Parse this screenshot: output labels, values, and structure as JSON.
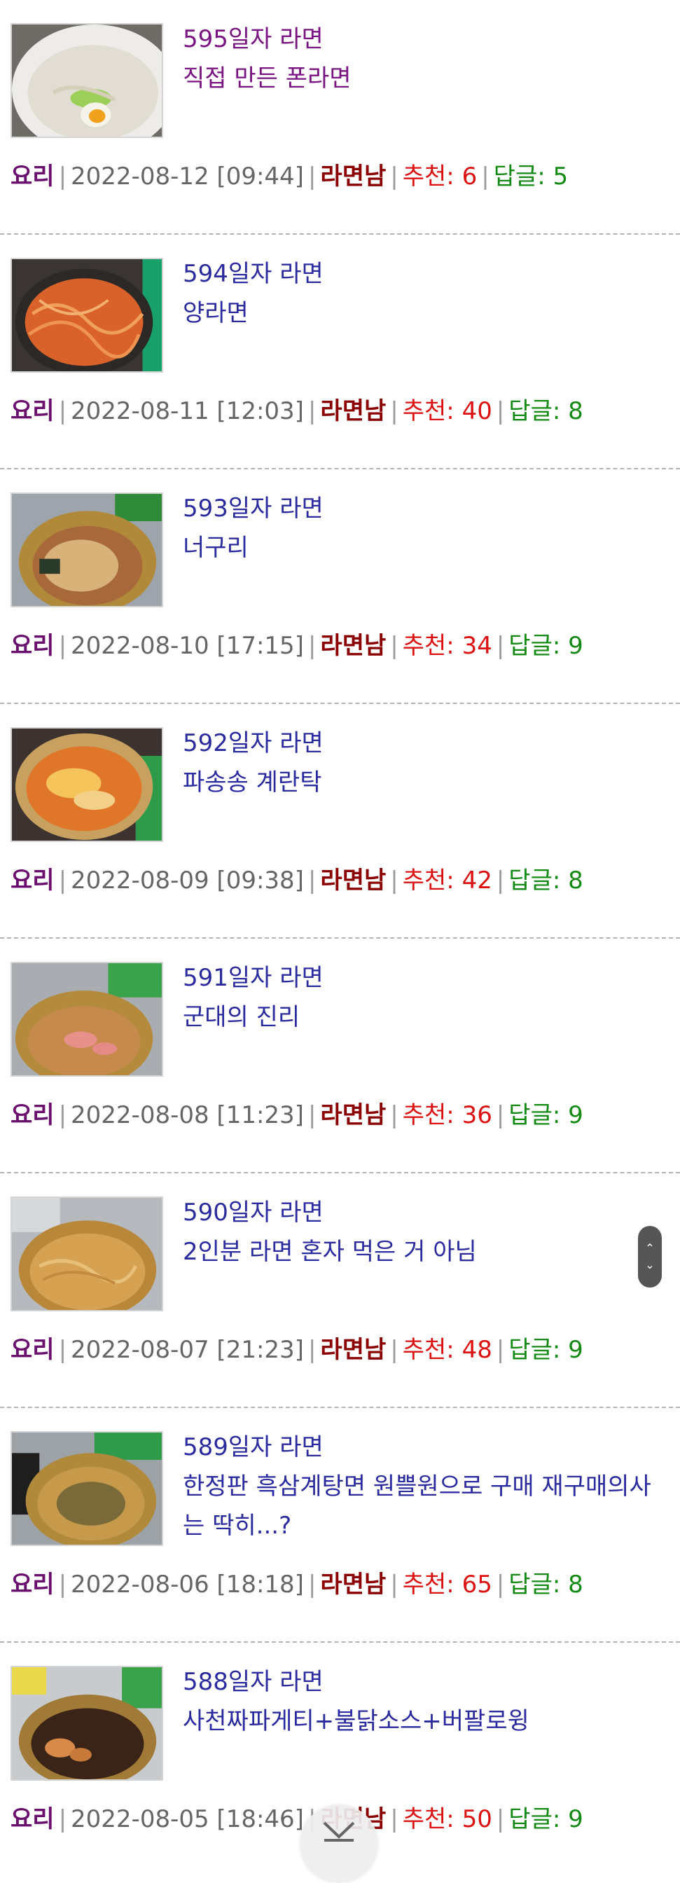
{
  "posts": [
    {
      "day": "595일자 라면",
      "title": "직접 만든 폰라면",
      "category": "요리",
      "date": "2022-08-12 [09:44]",
      "author": "라면남",
      "recommend_label": "추천:",
      "recommend": "6",
      "reply_label": "답글:",
      "replies": "5",
      "visited": true
    },
    {
      "day": "594일자 라면",
      "title": "양라면",
      "category": "요리",
      "date": "2022-08-11 [12:03]",
      "author": "라면남",
      "recommend_label": "추천:",
      "recommend": "40",
      "reply_label": "답글:",
      "replies": "8",
      "visited": false
    },
    {
      "day": "593일자 라면",
      "title": "너구리",
      "category": "요리",
      "date": "2022-08-10 [17:15]",
      "author": "라면남",
      "recommend_label": "추천:",
      "recommend": "34",
      "reply_label": "답글:",
      "replies": "9",
      "visited": false
    },
    {
      "day": "592일자 라면",
      "title": "파송송 계란탁",
      "category": "요리",
      "date": "2022-08-09 [09:38]",
      "author": "라면남",
      "recommend_label": "추천:",
      "recommend": "42",
      "reply_label": "답글:",
      "replies": "8",
      "visited": false
    },
    {
      "day": "591일자 라면",
      "title": "군대의 진리",
      "category": "요리",
      "date": "2022-08-08 [11:23]",
      "author": "라면남",
      "recommend_label": "추천:",
      "recommend": "36",
      "reply_label": "답글:",
      "replies": "9",
      "visited": false
    },
    {
      "day": "590일자 라면",
      "title": "2인분 라면 혼자 먹은 거 아님",
      "category": "요리",
      "date": "2022-08-07 [21:23]",
      "author": "라면남",
      "recommend_label": "추천:",
      "recommend": "48",
      "reply_label": "답글:",
      "replies": "9",
      "visited": false
    },
    {
      "day": "589일자 라면",
      "title": "한정판 흑삼계탕면 원쁠원으로 구매 재구매의사는 딱히...?",
      "category": "요리",
      "date": "2022-08-06 [18:18]",
      "author": "라면남",
      "recommend_label": "추천:",
      "recommend": "65",
      "reply_label": "답글:",
      "replies": "8",
      "visited": false
    },
    {
      "day": "588일자 라면",
      "title": "사천짜파게티+불닭소스+버팔로윙",
      "category": "요리",
      "date": "2022-08-05 [18:46]",
      "author": "라면남",
      "recommend_label": "추천:",
      "recommend": "50",
      "reply_label": "답글:",
      "replies": "9",
      "visited": false
    }
  ],
  "scroll_pill": {
    "up": "⌃",
    "down": "⌄"
  },
  "colors": {
    "link": "#2b2ba0",
    "visited": "#7a1482",
    "category": "#6b0f6f",
    "author": "#8b0000",
    "recommend": "#dd1111",
    "replies": "#138a13"
  }
}
